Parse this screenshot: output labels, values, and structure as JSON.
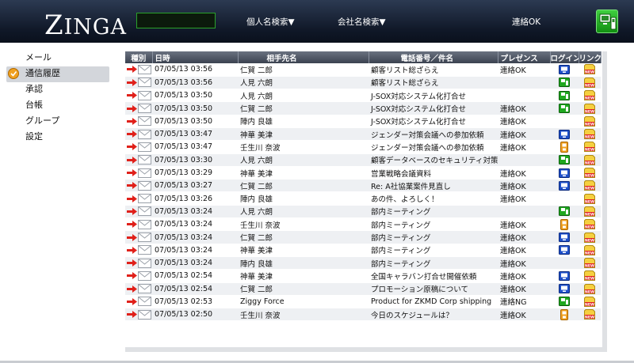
{
  "header": {
    "logo": "ZINGA",
    "search_value": "",
    "person_search": "個人名検索▼",
    "company_search": "会社名検索▼",
    "status": "連絡OK"
  },
  "sidebar": {
    "items": [
      {
        "label": "メール",
        "active": false
      },
      {
        "label": "通信履歴",
        "active": true
      },
      {
        "label": "承認",
        "active": false
      },
      {
        "label": "台帳",
        "active": false
      },
      {
        "label": "グループ",
        "active": false
      },
      {
        "label": "設定",
        "active": false
      }
    ]
  },
  "table": {
    "headers": [
      "種別",
      "日時",
      "相手先名",
      "電話番号／件名",
      "プレゼンス",
      "ログイン",
      "リンク"
    ],
    "rows": [
      {
        "datetime": "07/05/13 03:56",
        "name": "仁賀 二郎",
        "subject": "顧客リスト総ざらえ",
        "presence": "連絡OK",
        "login": "pc"
      },
      {
        "datetime": "07/05/13 03:56",
        "name": "人見 六朗",
        "subject": "顧客リスト総ざらえ",
        "presence": "",
        "login": "phone"
      },
      {
        "datetime": "07/05/13 03:50",
        "name": "人見 六朗",
        "subject": "J-SOX対応システム化打合せ",
        "presence": "",
        "login": "phone"
      },
      {
        "datetime": "07/05/13 03:50",
        "name": "仁賀 二郎",
        "subject": "J-SOX対応システム化打合せ",
        "presence": "連絡OK",
        "login": "phone"
      },
      {
        "datetime": "07/05/13 03:50",
        "name": "陣内 良雄",
        "subject": "J-SOX対応システム化打合せ",
        "presence": "連絡OK",
        "login": ""
      },
      {
        "datetime": "07/05/13 03:47",
        "name": "神華 美津",
        "subject": "ジェンダー対策会議への参加依頼",
        "presence": "連絡OK",
        "login": "pc"
      },
      {
        "datetime": "07/05/13 03:47",
        "name": "壬生川 奈波",
        "subject": "ジェンダー対策会議への参加依頼",
        "presence": "連絡OK",
        "login": "orange"
      },
      {
        "datetime": "07/05/13 03:30",
        "name": "人見 六朗",
        "subject": "顧客データベースのセキュリティ対策",
        "presence": "",
        "login": "phone"
      },
      {
        "datetime": "07/05/13 03:29",
        "name": "神華 美津",
        "subject": "営業戦略会議資料",
        "presence": "連絡OK",
        "login": "pc"
      },
      {
        "datetime": "07/05/13 03:27",
        "name": "仁賀 二郎",
        "subject": "Re:  A社協業案件見直し",
        "presence": "連絡OK",
        "login": "pc"
      },
      {
        "datetime": "07/05/13 03:26",
        "name": "陣内 良雄",
        "subject": "あの件、よろしく！",
        "presence": "連絡OK",
        "login": ""
      },
      {
        "datetime": "07/05/13 03:24",
        "name": "人見 六朗",
        "subject": "部内ミーティング",
        "presence": "",
        "login": "phone"
      },
      {
        "datetime": "07/05/13 03:24",
        "name": "壬生川 奈波",
        "subject": "部内ミーティング",
        "presence": "連絡OK",
        "login": "orange"
      },
      {
        "datetime": "07/05/13 03:24",
        "name": "仁賀 二郎",
        "subject": "部内ミーティング",
        "presence": "連絡OK",
        "login": "pc"
      },
      {
        "datetime": "07/05/13 03:24",
        "name": "神華 美津",
        "subject": "部内ミーティング",
        "presence": "連絡OK",
        "login": "pc"
      },
      {
        "datetime": "07/05/13 03:24",
        "name": "陣内 良雄",
        "subject": "部内ミーティング",
        "presence": "連絡OK",
        "login": ""
      },
      {
        "datetime": "07/05/13 02:54",
        "name": "神華 美津",
        "subject": "全国キャラバン打合せ開催依頼",
        "presence": "連絡OK",
        "login": "pc"
      },
      {
        "datetime": "07/05/13 02:54",
        "name": "仁賀 二郎",
        "subject": "プロモーション原稿について",
        "presence": "連絡OK",
        "login": "pc"
      },
      {
        "datetime": "07/05/13 02:53",
        "name": "Ziggy Force",
        "subject": "Product for ZKMD Corp shipping",
        "presence": "連絡NG",
        "login": "phone"
      },
      {
        "datetime": "07/05/13 02:50",
        "name": "壬生川 奈波",
        "subject": "今日のスケジュールは？",
        "presence": "連絡OK",
        "login": "orange"
      }
    ]
  },
  "colors": {
    "header_bg": "#101828",
    "accent_green": "#1fa81f",
    "arrow_red": "#e0201a",
    "pc_blue": "#1e4fc8",
    "orange": "#f0a020",
    "row_alt": "#eef0f3"
  },
  "icons": {
    "type": [
      "right-arrow-icon",
      "envelope-icon"
    ],
    "login": {
      "pc": "pc-login-icon",
      "phone": "phone-login-icon",
      "orange": "mobile-login-icon"
    },
    "link": "new-link-icon",
    "header": "phone-device-icon"
  }
}
